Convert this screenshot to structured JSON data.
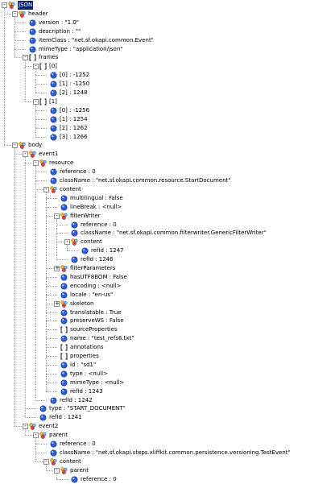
{
  "window": {
    "title": ""
  },
  "tree": [
    {
      "d": 0,
      "t": "obj",
      "x": "-",
      "label": "JSON",
      "selected": true
    },
    {
      "d": 1,
      "t": "obj",
      "x": "-",
      "label": "header"
    },
    {
      "d": 2,
      "t": "val",
      "label": "version : \"1.0\""
    },
    {
      "d": 2,
      "t": "val",
      "label": "description : \"\""
    },
    {
      "d": 2,
      "t": "val",
      "label": "itemClass : \"net.sf.okapi.common.Event\""
    },
    {
      "d": 2,
      "t": "val",
      "label": "mimeType : \"application/json\""
    },
    {
      "d": 2,
      "t": "arr",
      "x": "-",
      "label": "frames"
    },
    {
      "d": 3,
      "t": "arr",
      "x": "-",
      "label": "[0]"
    },
    {
      "d": 4,
      "t": "val",
      "label": "[0] : -1252"
    },
    {
      "d": 4,
      "t": "val",
      "label": "[1] : -1250"
    },
    {
      "d": 4,
      "t": "val",
      "label": "[2] : 1248"
    },
    {
      "d": 3,
      "t": "arr",
      "x": "-",
      "label": "[1]"
    },
    {
      "d": 4,
      "t": "val",
      "label": "[0] : -1256"
    },
    {
      "d": 4,
      "t": "val",
      "label": "[1] : 1254"
    },
    {
      "d": 4,
      "t": "val",
      "label": "[2] : 1262"
    },
    {
      "d": 4,
      "t": "val",
      "label": "[3] : 1266"
    },
    {
      "d": 1,
      "t": "obj",
      "x": "-",
      "label": "body"
    },
    {
      "d": 2,
      "t": "obj",
      "x": "-",
      "label": "event1"
    },
    {
      "d": 3,
      "t": "obj",
      "x": "-",
      "label": "resource"
    },
    {
      "d": 4,
      "t": "val",
      "label": "reference : 0"
    },
    {
      "d": 4,
      "t": "val",
      "label": "className : \"net.sf.okapi.common.resource.StartDocument\""
    },
    {
      "d": 4,
      "t": "obj",
      "x": "-",
      "label": "content"
    },
    {
      "d": 5,
      "t": "val",
      "label": "multilingual : False"
    },
    {
      "d": 5,
      "t": "val",
      "label": "lineBreak : <null>"
    },
    {
      "d": 5,
      "t": "obj",
      "x": "-",
      "label": "filterWriter"
    },
    {
      "d": 6,
      "t": "val",
      "label": "reference : 0"
    },
    {
      "d": 6,
      "t": "val",
      "label": "className : \"net.sf.okapi.common.filterwriter.GenericFilterWriter\""
    },
    {
      "d": 6,
      "t": "obj",
      "x": "-",
      "label": "content"
    },
    {
      "d": 7,
      "t": "val",
      "label": "refId : 1247"
    },
    {
      "d": 6,
      "t": "val",
      "label": "refId : 1246"
    },
    {
      "d": 5,
      "t": "obj",
      "x": "+",
      "label": "filterParameters"
    },
    {
      "d": 5,
      "t": "val",
      "label": "hasUTF8BOM : False"
    },
    {
      "d": 5,
      "t": "val",
      "label": "encoding : <null>"
    },
    {
      "d": 5,
      "t": "val",
      "label": "locale : \"en-us\""
    },
    {
      "d": 5,
      "t": "obj",
      "x": "+",
      "label": "skeleton"
    },
    {
      "d": 5,
      "t": "val",
      "label": "translatable : True"
    },
    {
      "d": 5,
      "t": "val",
      "label": "preserveWS : False"
    },
    {
      "d": 5,
      "t": "arr",
      "label": "sourceProperties"
    },
    {
      "d": 5,
      "t": "val",
      "label": "name : \"test_refs6.txt\""
    },
    {
      "d": 5,
      "t": "arr",
      "label": "annotations"
    },
    {
      "d": 5,
      "t": "arr",
      "label": "properties"
    },
    {
      "d": 5,
      "t": "val",
      "label": "id : \"sd1\""
    },
    {
      "d": 5,
      "t": "val",
      "label": "type : <null>"
    },
    {
      "d": 5,
      "t": "val",
      "label": "mimeType : <null>"
    },
    {
      "d": 5,
      "t": "val",
      "label": "refId : 1243"
    },
    {
      "d": 4,
      "t": "val",
      "label": "refId : 1242"
    },
    {
      "d": 3,
      "t": "val",
      "label": "type : \"START_DOCUMENT\""
    },
    {
      "d": 3,
      "t": "val",
      "label": "refId : 1241"
    },
    {
      "d": 2,
      "t": "obj",
      "x": "-",
      "label": "event2"
    },
    {
      "d": 3,
      "t": "obj",
      "x": "-",
      "label": "parent"
    },
    {
      "d": 4,
      "t": "val",
      "label": "reference : 0"
    },
    {
      "d": 4,
      "t": "val",
      "label": "className : \"net.sf.okapi.steps.xliffkit.common.persistence.versioning.TestEvent\""
    },
    {
      "d": 4,
      "t": "obj",
      "x": "-",
      "label": "content"
    },
    {
      "d": 5,
      "t": "obj",
      "x": "-",
      "label": "parent"
    },
    {
      "d": 6,
      "t": "val",
      "label": "reference : 0"
    }
  ]
}
